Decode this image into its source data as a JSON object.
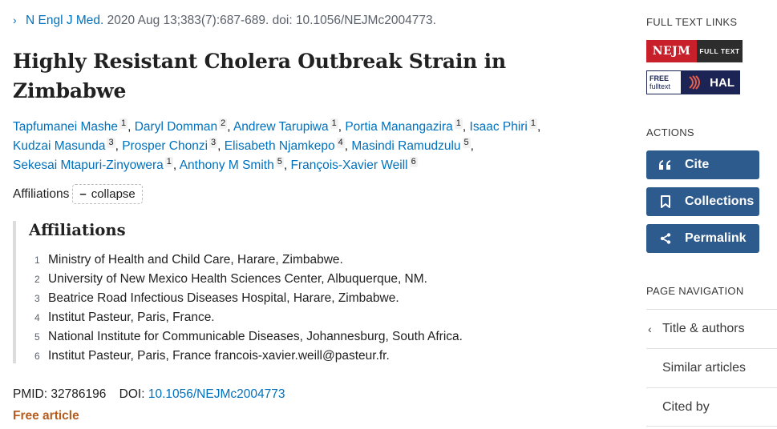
{
  "citation": {
    "journal": "N Engl J Med.",
    "details": "2020 Aug 13;383(7):687-689. doi: 10.1056/NEJMc2004773."
  },
  "article": {
    "title": "Highly Resistant Cholera Outbreak Strain in Zimbabwe"
  },
  "authors": [
    {
      "name": "Tapfumanei Mashe",
      "aff": "1"
    },
    {
      "name": "Daryl Domman",
      "aff": "2"
    },
    {
      "name": "Andrew Tarupiwa",
      "aff": "1"
    },
    {
      "name": "Portia Manangazira",
      "aff": "1"
    },
    {
      "name": "Isaac Phiri",
      "aff": "1"
    },
    {
      "name": "Kudzai Masunda",
      "aff": "3"
    },
    {
      "name": "Prosper Chonzi",
      "aff": "3"
    },
    {
      "name": "Elisabeth Njamkepo",
      "aff": "4"
    },
    {
      "name": "Masindi Ramudzulu",
      "aff": "5"
    },
    {
      "name": "Sekesai Mtapuri-Zinyowera",
      "aff": "1"
    },
    {
      "name": "Anthony M Smith",
      "aff": "5"
    },
    {
      "name": "François-Xavier Weill",
      "aff": "6"
    }
  ],
  "affiliations_toggle": {
    "label": "Affiliations",
    "button_label": "collapse"
  },
  "affiliations": {
    "heading": "Affiliations",
    "items": [
      {
        "num": "1",
        "text": "Ministry of Health and Child Care, Harare, Zimbabwe."
      },
      {
        "num": "2",
        "text": "University of New Mexico Health Sciences Center, Albuquerque, NM."
      },
      {
        "num": "3",
        "text": "Beatrice Road Infectious Diseases Hospital, Harare, Zimbabwe."
      },
      {
        "num": "4",
        "text": "Institut Pasteur, Paris, France."
      },
      {
        "num": "5",
        "text": "National Institute for Communicable Diseases, Johannesburg, South Africa."
      },
      {
        "num": "6",
        "text": "Institut Pasteur, Paris, France francois-xavier.weill@pasteur.fr."
      }
    ]
  },
  "ids": {
    "pmid_label": "PMID:",
    "pmid": "32786196",
    "doi_label": "DOI:",
    "doi": "10.1056/NEJMc2004773"
  },
  "free_article": "Free article",
  "sidebar": {
    "full_text_heading": "FULL TEXT LINKS",
    "nejm_logo": {
      "left": "NEJM",
      "right": "FULL TEXT"
    },
    "hal_logo": {
      "free": "FREE",
      "fulltext": "fulltext",
      "hal": "HAL"
    },
    "actions_heading": "ACTIONS",
    "actions": {
      "cite": "Cite",
      "collections": "Collections",
      "permalink": "Permalink"
    },
    "page_nav_heading": "PAGE NAVIGATION",
    "page_nav": [
      "Title & authors",
      "Similar articles",
      "Cited by"
    ]
  },
  "colors": {
    "link": "#0071bc",
    "button": "#2e5b8e",
    "free_article": "#b55d1f",
    "nejm_red": "#c8202b",
    "hal_navy": "#1c2455"
  }
}
